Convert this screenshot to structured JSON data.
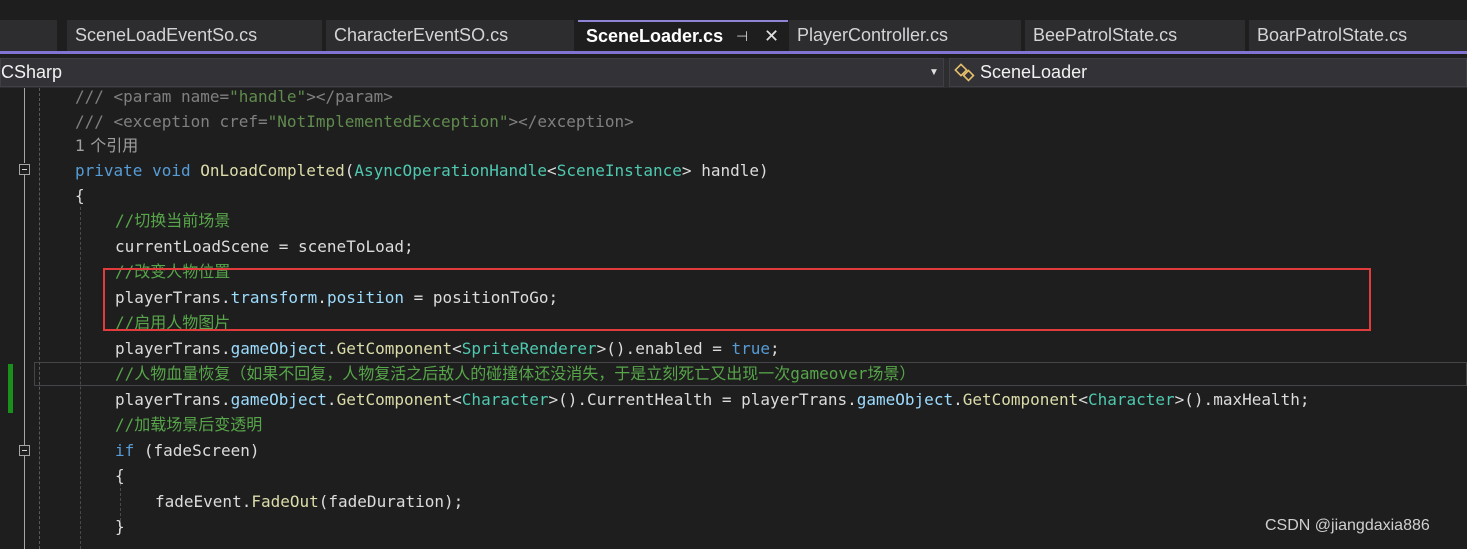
{
  "tabs": [
    {
      "label": "SceneLoadEventSo.cs",
      "active": false
    },
    {
      "label": "CharacterEventSO.cs",
      "active": false
    },
    {
      "label": "SceneLoader.cs",
      "active": true
    },
    {
      "label": "PlayerController.cs",
      "active": false
    },
    {
      "label": "BeePatrolState.cs",
      "active": false
    },
    {
      "label": "BoarPatrolState.cs",
      "active": false
    }
  ],
  "icons": {
    "pin": "pin-icon",
    "close": "close-icon",
    "dropdown": "dropdown-arrow-icon",
    "class": "class-member-icon"
  },
  "navbar": {
    "project": "CSharp",
    "member": "SceneLoader"
  },
  "code": {
    "l1": [
      "/// <param name=",
      "\"handle\"",
      "></param>"
    ],
    "l2": [
      "/// <exception cref=",
      "\"NotImplementedException\"",
      "></exception>"
    ],
    "l3": "1 个引用",
    "l4": [
      "private",
      "void",
      "OnLoadCompleted",
      "(",
      "AsyncOperationHandle",
      "<",
      "SceneInstance",
      "> handle)"
    ],
    "l5": "{",
    "l6": "//切换当前场景",
    "l7": "currentLoadScene = sceneToLoad;",
    "l8": "//改变人物位置",
    "l9": [
      "playerTrans.",
      "transform",
      ".",
      "position",
      " = positionToGo;"
    ],
    "l10": "//启用人物图片",
    "l11": [
      "playerTrans.",
      "gameObject",
      ".",
      "GetComponent",
      "<",
      "SpriteRenderer",
      ">().enabled = ",
      "true",
      ";"
    ],
    "l12": "//人物血量恢复（如果不回复，人物复活之后敌人的碰撞体还没消失，于是立刻死亡又出现一次gameover场景）",
    "l13": [
      "playerTrans.",
      "gameObject",
      ".",
      "GetComponent",
      "<",
      "Character",
      ">().CurrentHealth = playerTrans.",
      "gameObject",
      ".",
      "GetComponent",
      "<",
      "Character",
      ">().maxHealth;"
    ],
    "l14": "//加载场景后变透明",
    "l15": [
      "if",
      " (fadeScreen)"
    ],
    "l16": "{",
    "l17": [
      "fadeEvent.",
      "FadeOut",
      "(fadeDuration);"
    ],
    "l18": "}"
  },
  "watermark": "CSDN @jiangdaxia886"
}
